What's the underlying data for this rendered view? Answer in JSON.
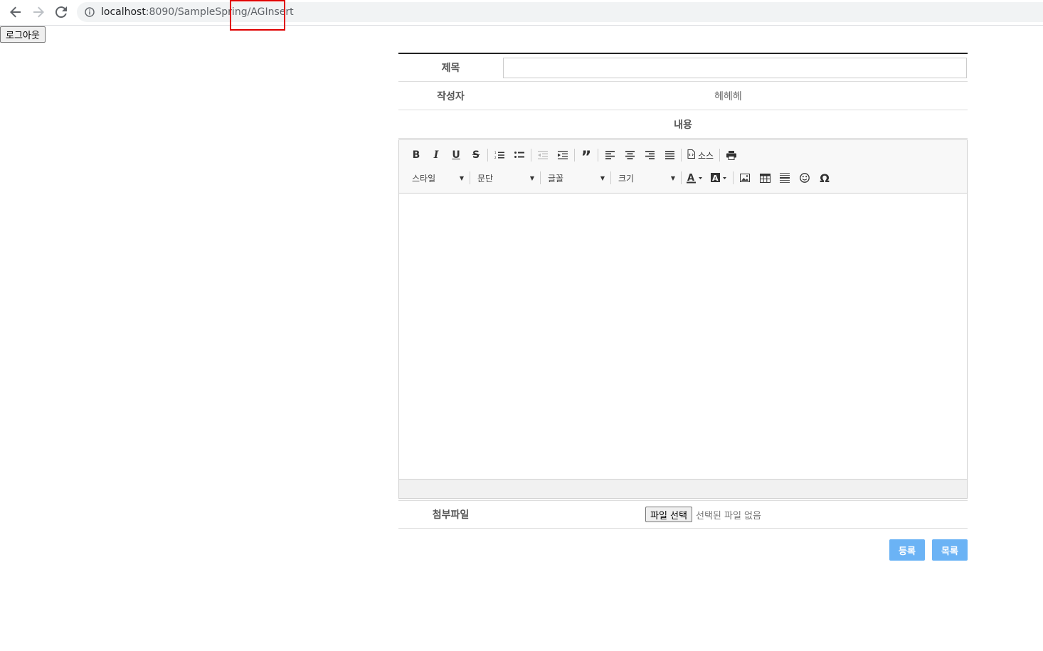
{
  "browser": {
    "url_host": "localhost",
    "url_rest": ":8090/SampleSpring/AGInsert"
  },
  "header": {
    "logout_label": "로그아웃"
  },
  "form": {
    "title_label": "제목",
    "title_value": "",
    "writer_label": "작성자",
    "writer_value": "헤헤헤",
    "content_label": "내용",
    "attachment_label": "첨부파일",
    "file_button_label": "파일 선택",
    "file_status": "선택된 파일 없음"
  },
  "editor": {
    "bold": "B",
    "italic": "I",
    "underline": "U",
    "strike": "S",
    "source_label": "소스",
    "style_combo": "스타일",
    "format_combo": "문단",
    "font_combo": "글꼴",
    "size_combo": "크기"
  },
  "actions": {
    "submit_label": "등록",
    "list_label": "목록"
  },
  "colors": {
    "accent": "#6bb3f5",
    "highlight": "#e00000"
  }
}
